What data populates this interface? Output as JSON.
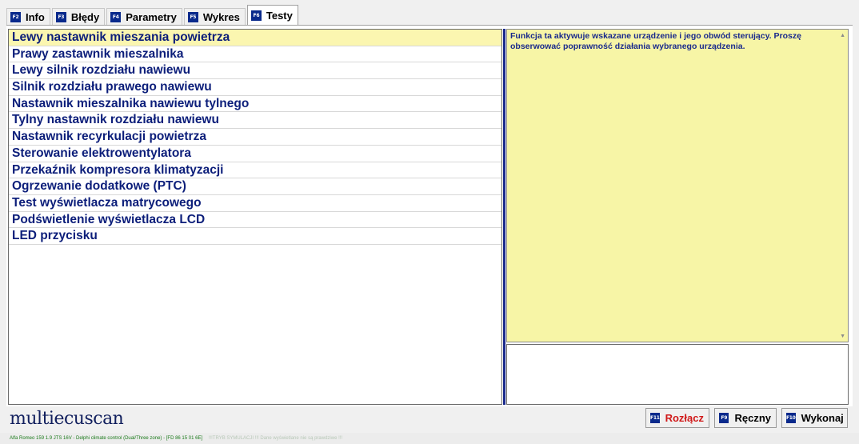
{
  "tabs": [
    {
      "key": "F2",
      "label": "Info",
      "active": false
    },
    {
      "key": "F3",
      "label": "Błędy",
      "active": false
    },
    {
      "key": "F4",
      "label": "Parametry",
      "active": false
    },
    {
      "key": "F5",
      "label": "Wykres",
      "active": false
    },
    {
      "key": "F6",
      "label": "Testy",
      "active": true
    }
  ],
  "tests": [
    "Lewy nastawnik mieszania powietrza",
    "Prawy zastawnik mieszalnika",
    "Lewy silnik rozdziału nawiewu",
    "Silnik rozdziału prawego nawiewu",
    "Nastawnik mieszalnika nawiewu tylnego",
    "Tylny nastawnik rozdziału nawiewu",
    "Nastawnik recyrkulacji powietrza",
    "Sterowanie elektrowentylatora",
    "Przekaźnik kompresora klimatyzacji",
    "Ogrzewanie dodatkowe (PTC)",
    "Test wyświetlacza matrycowego",
    "Podświetlenie wyświetlacza LCD",
    "LED przycisku"
  ],
  "selected_index": 0,
  "description": "Funkcja ta aktywuje wskazane urządzenie i jego obwód sterujący. Proszę obserwować poprawność działania wybranego urządzenia.",
  "logo": "multiecuscan",
  "buttons": {
    "disconnect": {
      "key": "F11",
      "label": "Rozłącz"
    },
    "manual": {
      "key": "F9",
      "label": "Ręczny"
    },
    "execute": {
      "key": "F10",
      "label": "Wykonaj"
    }
  },
  "status": {
    "vehicle": "Alfa Romeo 159 1.9 JTS 16V - Delphi climate control (Dual/Three zone) - [FD 86 15 01 6E]",
    "simulation": "!!!TRYB SYMULACJI !!! Dane wyświetlane nie są prawdziwe !!!"
  },
  "colors": {
    "accent": "#0a2a8c",
    "list_text": "#0c1e7a",
    "selected_row": "#fbf6b0",
    "description_bg": "#f7f5a6",
    "disconnect": "#d01818",
    "status_green": "#1a7a1a"
  }
}
